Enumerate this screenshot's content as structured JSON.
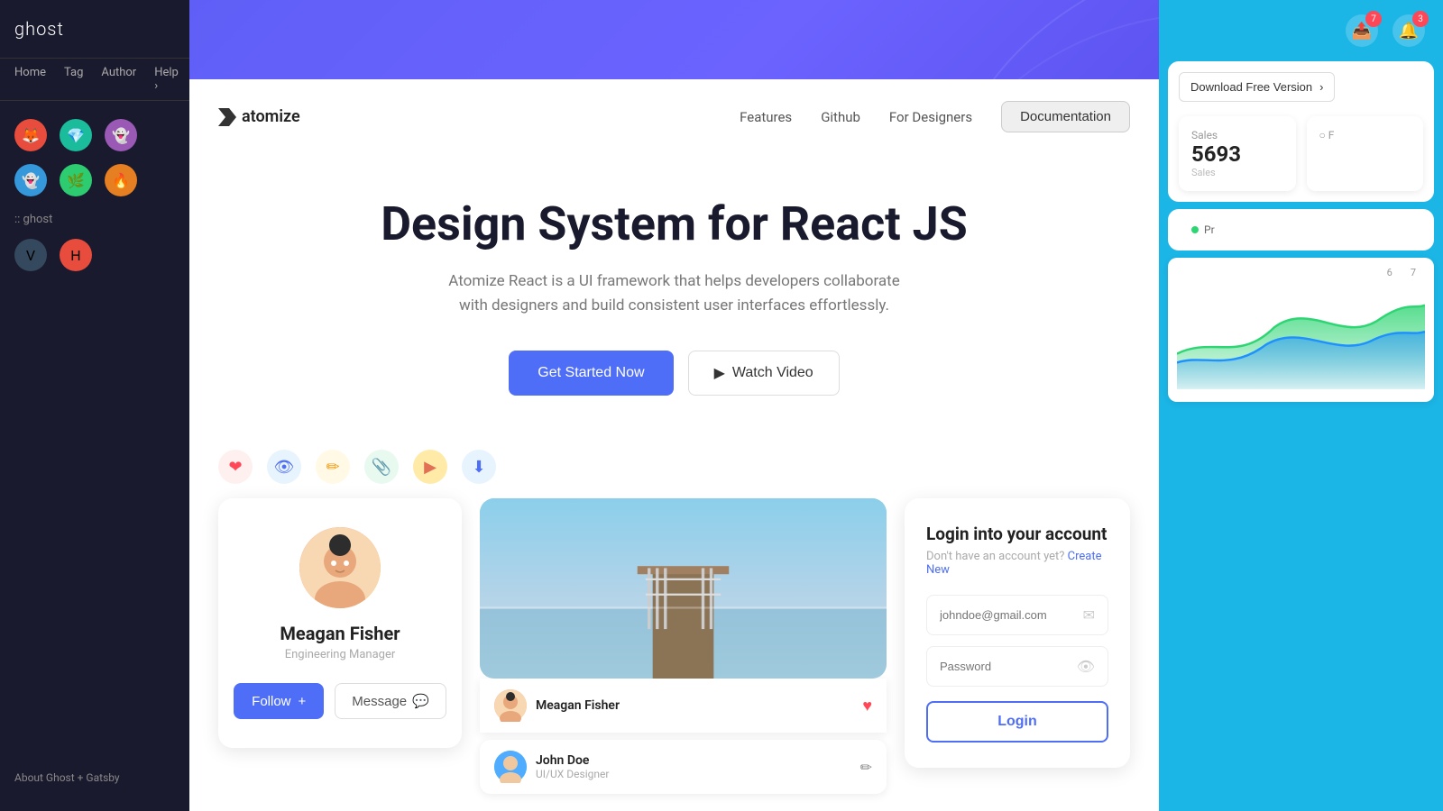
{
  "page": {
    "title": "Atomize - Design System for React JS"
  },
  "left_sidebar": {
    "title": "ghost",
    "nav_items": [
      "Home",
      "Tag",
      "Author",
      "Help"
    ],
    "bottom_text": "About Ghost + Gatsby"
  },
  "right_sidebar": {
    "notifications_badge1": "7",
    "notifications_badge2": "3",
    "download_button": "Download Free Version",
    "sales_label": "Sales",
    "sales_value": "5693",
    "sales_sublabel": "Sales",
    "pr_label": "Pr",
    "chart_labels": [
      "6",
      "7"
    ]
  },
  "nav": {
    "logo": "atomize",
    "links": [
      "Features",
      "Github",
      "For Designers"
    ],
    "doc_link": "Documentation"
  },
  "hero": {
    "title": "Design System for React JS",
    "subtitle": "Atomize React is a UI framework that helps developers collaborate with designers and build consistent user interfaces effortlessly.",
    "cta_primary": "Get Started Now",
    "cta_secondary": "Watch Video"
  },
  "toolbar": {
    "icons": [
      "❤",
      "👁",
      "✏",
      "📎",
      "▶",
      "⬇"
    ]
  },
  "profile_card": {
    "name": "Meagan Fisher",
    "role": "Engineering Manager",
    "follow_label": "Follow",
    "follow_icon": "+",
    "message_label": "Message"
  },
  "photo_card": {
    "user1_name": "Meagan Fisher",
    "user2_name": "John Doe",
    "user2_role": "UI/UX Designer"
  },
  "login_card": {
    "title": "Login into your account",
    "subtitle": "Don't have an account yet?",
    "create_link": "Create New",
    "email_placeholder": "johndoe@gmail.com",
    "password_placeholder": "Password",
    "login_label": "Login"
  }
}
